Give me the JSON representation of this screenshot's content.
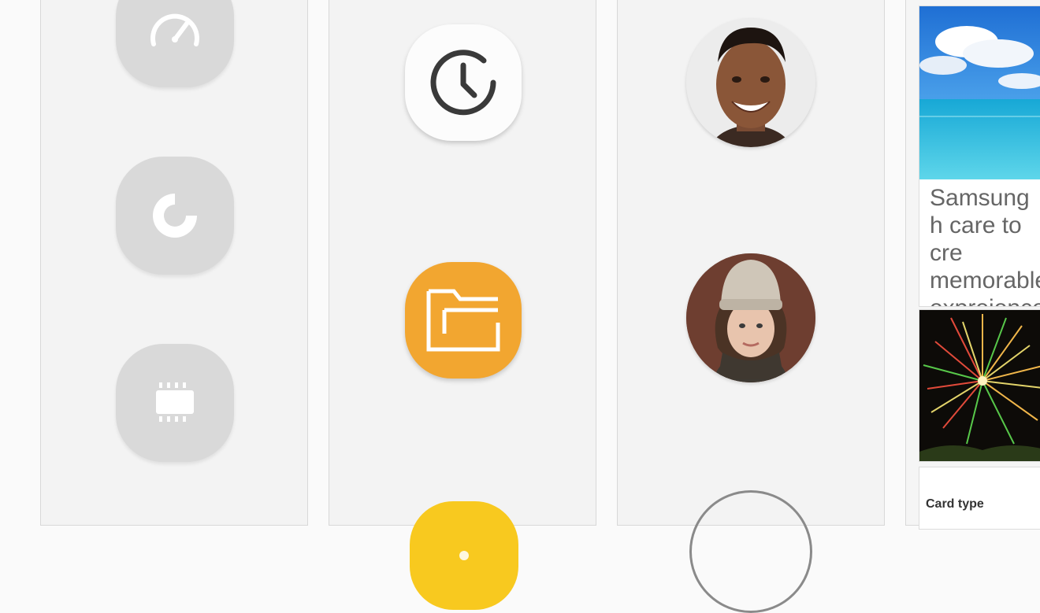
{
  "colors": {
    "panel_bg": "#f3f3f3",
    "grey_icon": "#d9d9d9",
    "orange_icon": "#f2a630",
    "yellow_icon": "#f8c91f",
    "clock_stroke": "#3a3a3a"
  },
  "column1": {
    "icons": [
      "speedometer-icon",
      "storage-pie-icon",
      "memory-chip-icon"
    ]
  },
  "column2": {
    "icons": [
      "clock-icon",
      "folder-icon",
      "yellow-app-icon"
    ]
  },
  "column3": {
    "avatars": [
      "smiling-man-avatar",
      "woman-knit-hat-avatar",
      "empty-avatar-ring"
    ]
  },
  "column4": {
    "cards": [
      {
        "image": "ocean-beach-photo",
        "text": "Samsung h care to cre memorable expreience"
      },
      {
        "image": "fireworks-photo"
      },
      {
        "label": "Card type"
      }
    ]
  }
}
